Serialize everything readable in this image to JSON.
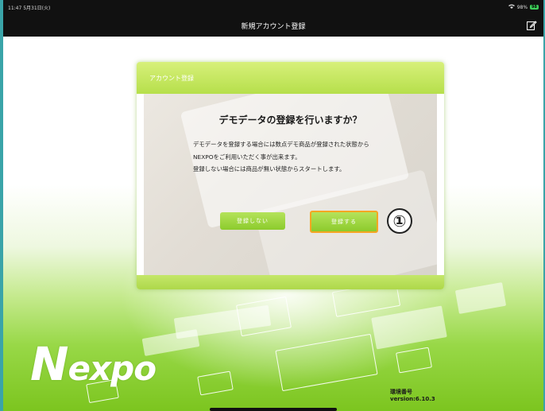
{
  "status_bar": {
    "time": "11:47",
    "date": "5月31日(火)",
    "wifi_icon": "wifi-icon",
    "battery_percent": "98%",
    "battery_label": "98"
  },
  "navbar": {
    "title": "新規アカウント登録",
    "edit_icon": "edit-icon"
  },
  "dialog": {
    "header": "アカウント登録",
    "title": "デモデータの登録を行いますか？",
    "lines": [
      "デモデータを登録する場合には数点デモ商品が登録された状態から",
      "NEXPOをご利用いただく事が出来ます。",
      "登録しない場合には商品が無い状態からスタートします。"
    ],
    "no_button": "登録しない",
    "yes_button": "登録する"
  },
  "annotation": {
    "marker": "①"
  },
  "logo": {
    "text_n": "N",
    "text_rest": "expo"
  },
  "version": {
    "label": "環境番号",
    "value": "version:6.10.3"
  },
  "colors": {
    "accent_green": "#8ccb2c",
    "highlight_orange": "#f5a623",
    "navbar_bg": "#111111"
  }
}
